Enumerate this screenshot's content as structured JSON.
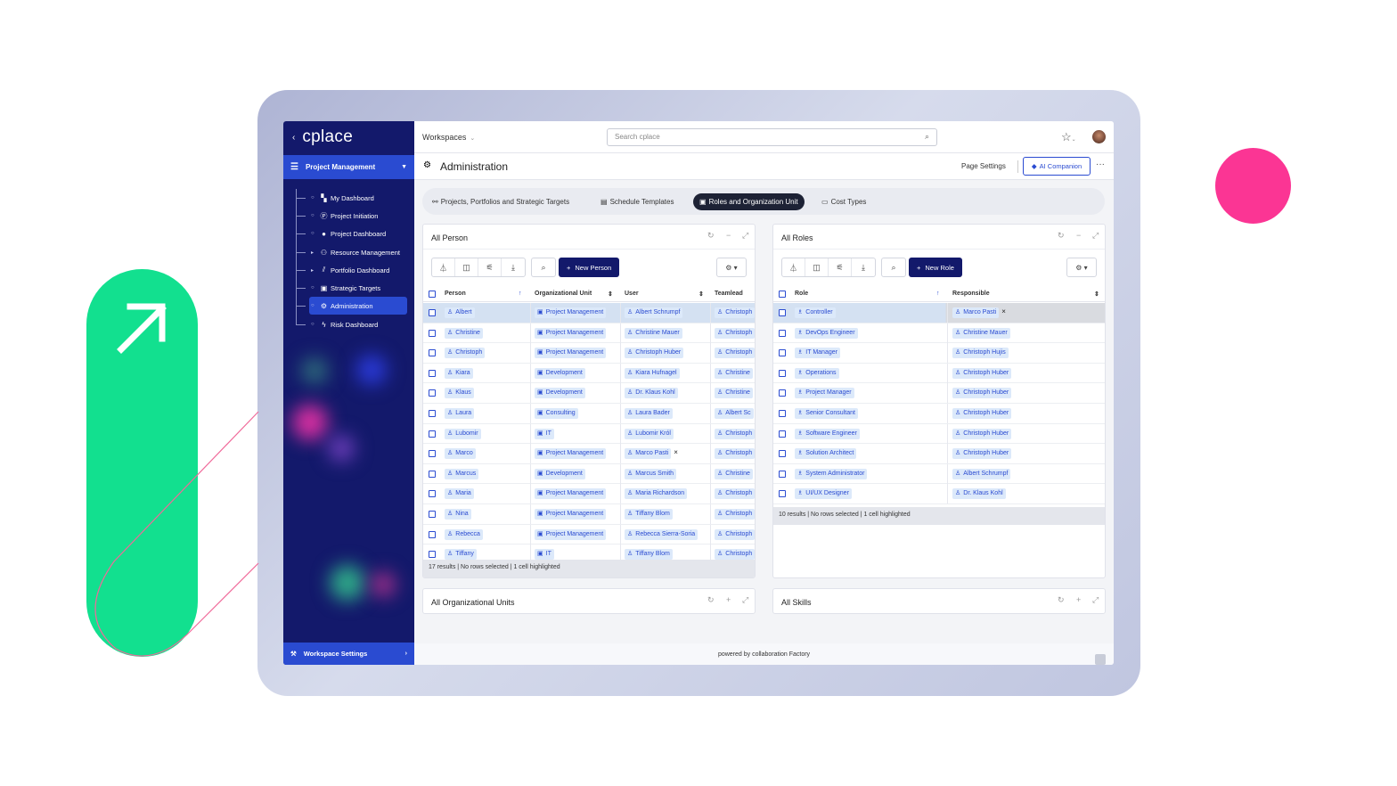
{
  "sidebar": {
    "logo": "cplace",
    "project": "Project Management",
    "items": [
      {
        "label": "My Dashboard",
        "icon": "dashboard-icon"
      },
      {
        "label": "Project Initiation",
        "icon": "p-circle-icon"
      },
      {
        "label": "Project Dashboard",
        "icon": "p-badge-icon"
      },
      {
        "label": "Resource Management",
        "icon": "people-icon"
      },
      {
        "label": "Portfolio Dashboard",
        "icon": "chart-icon"
      },
      {
        "label": "Strategic Targets",
        "icon": "org-icon"
      },
      {
        "label": "Administration",
        "icon": "admin-icon"
      },
      {
        "label": "Risk Dashboard",
        "icon": "lightning-icon"
      }
    ],
    "footer": "Workspace Settings"
  },
  "topbar": {
    "workspaces": "Workspaces",
    "search_placeholder": "Search cplace"
  },
  "page": {
    "title": "Administration",
    "page_settings": "Page Settings",
    "ai_companion": "AI Companion"
  },
  "tabs": [
    {
      "label": "Projects, Portfolios and Strategic Targets"
    },
    {
      "label": "Schedule Templates"
    },
    {
      "label": "Roles and Organization Unit",
      "active": true
    },
    {
      "label": "Cost Types"
    }
  ],
  "persons": {
    "title": "All Person",
    "new_button": "New Person",
    "columns": [
      "Person",
      "Organizational Unit",
      "User",
      "Teamlead"
    ],
    "rows": [
      [
        "Albert",
        "Project Management",
        "Albert Schrumpf",
        "Christoph"
      ],
      [
        "Christine",
        "Project Management",
        "Christine Mauer",
        "Christoph"
      ],
      [
        "Christoph",
        "Project Management",
        "Christoph Huber",
        "Christoph"
      ],
      [
        "Kiara",
        "Development",
        "Kiara Hufnagel",
        "Christine"
      ],
      [
        "Klaus",
        "Development",
        "Dr. Klaus Kohl",
        "Christine"
      ],
      [
        "Laura",
        "Consulting",
        "Laura Bader",
        "Albert Sc"
      ],
      [
        "Lubomir",
        "IT",
        "Lubomir Król",
        "Christoph"
      ],
      [
        "Marco",
        "Project Management",
        "Marco Pasti",
        "Christoph"
      ],
      [
        "Marcus",
        "Development",
        "Marcus Smith",
        "Christine"
      ],
      [
        "Maria",
        "Project Management",
        "Maria Richardson",
        "Christoph"
      ],
      [
        "Nina",
        "Project Management",
        "Tiffany Blom",
        "Christoph"
      ],
      [
        "Rebecca",
        "Project Management",
        "Rebecca Sierra-Soria",
        "Christoph"
      ],
      [
        "Tiffany",
        "IT",
        "Tiffany Blom",
        "Christoph"
      ]
    ],
    "status": "17 results | No rows selected | 1 cell highlighted"
  },
  "roles": {
    "title": "All Roles",
    "new_button": "New Role",
    "columns": [
      "Role",
      "Responsible"
    ],
    "rows": [
      [
        "Controller",
        "Marco Pasti"
      ],
      [
        "DevOps Engineer",
        "Christine Mauer"
      ],
      [
        "IT Manager",
        "Christoph Hujis"
      ],
      [
        "Operations",
        "Christoph Huber"
      ],
      [
        "Project Manager",
        "Christoph Huber"
      ],
      [
        "Senior Consultant",
        "Christoph Huber"
      ],
      [
        "Software Engineer",
        "Christoph Huber"
      ],
      [
        "Solution Architect",
        "Christoph Huber"
      ],
      [
        "System Administrator",
        "Albert Schrumpf"
      ],
      [
        "UI/UX Designer",
        "Dr. Klaus Kohl"
      ]
    ],
    "status": "10 results | No rows selected | 1 cell highlighted"
  },
  "org_units": {
    "title": "All Organizational Units"
  },
  "skills": {
    "title": "All Skills"
  },
  "footer": {
    "powered": "powered by collaboration Factory"
  },
  "colors": {
    "navy": "#13196b",
    "accent": "#2a4bd1",
    "green": "#12e08f",
    "pink": "#fb3594"
  }
}
